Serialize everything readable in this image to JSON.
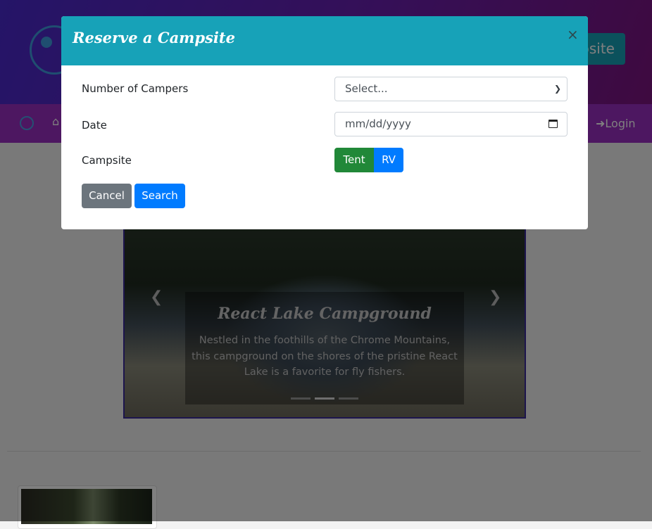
{
  "header": {
    "button_label": "psite"
  },
  "navbar": {
    "home_icon": "home-icon",
    "login_label": "Login"
  },
  "carousel": {
    "title": "React Lake Campground",
    "description": "Nestled in the foothills of the Chrome Mountains, this campground on the shores of the pristine React Lake is a favorite for fly fishers.",
    "indicators": 3,
    "active_indicator": 1
  },
  "modal": {
    "title": "Reserve a Campsite",
    "close_symbol": "×",
    "fields": {
      "campers_label": "Number of Campers",
      "campers_value": "Select...",
      "date_label": "Date",
      "date_placeholder": "mm/dd/yyyy",
      "campsite_label": "Campsite",
      "tent_label": "Tent",
      "rv_label": "RV",
      "selected_campsite": "Tent"
    },
    "buttons": {
      "cancel": "Cancel",
      "search": "Search"
    }
  },
  "colors": {
    "modal_header": "#17a2b8",
    "tent_selected": "#218838",
    "rv": "#007bff",
    "cancel": "#6c757d",
    "search": "#007bff",
    "navbar": "#9a2fc2"
  }
}
